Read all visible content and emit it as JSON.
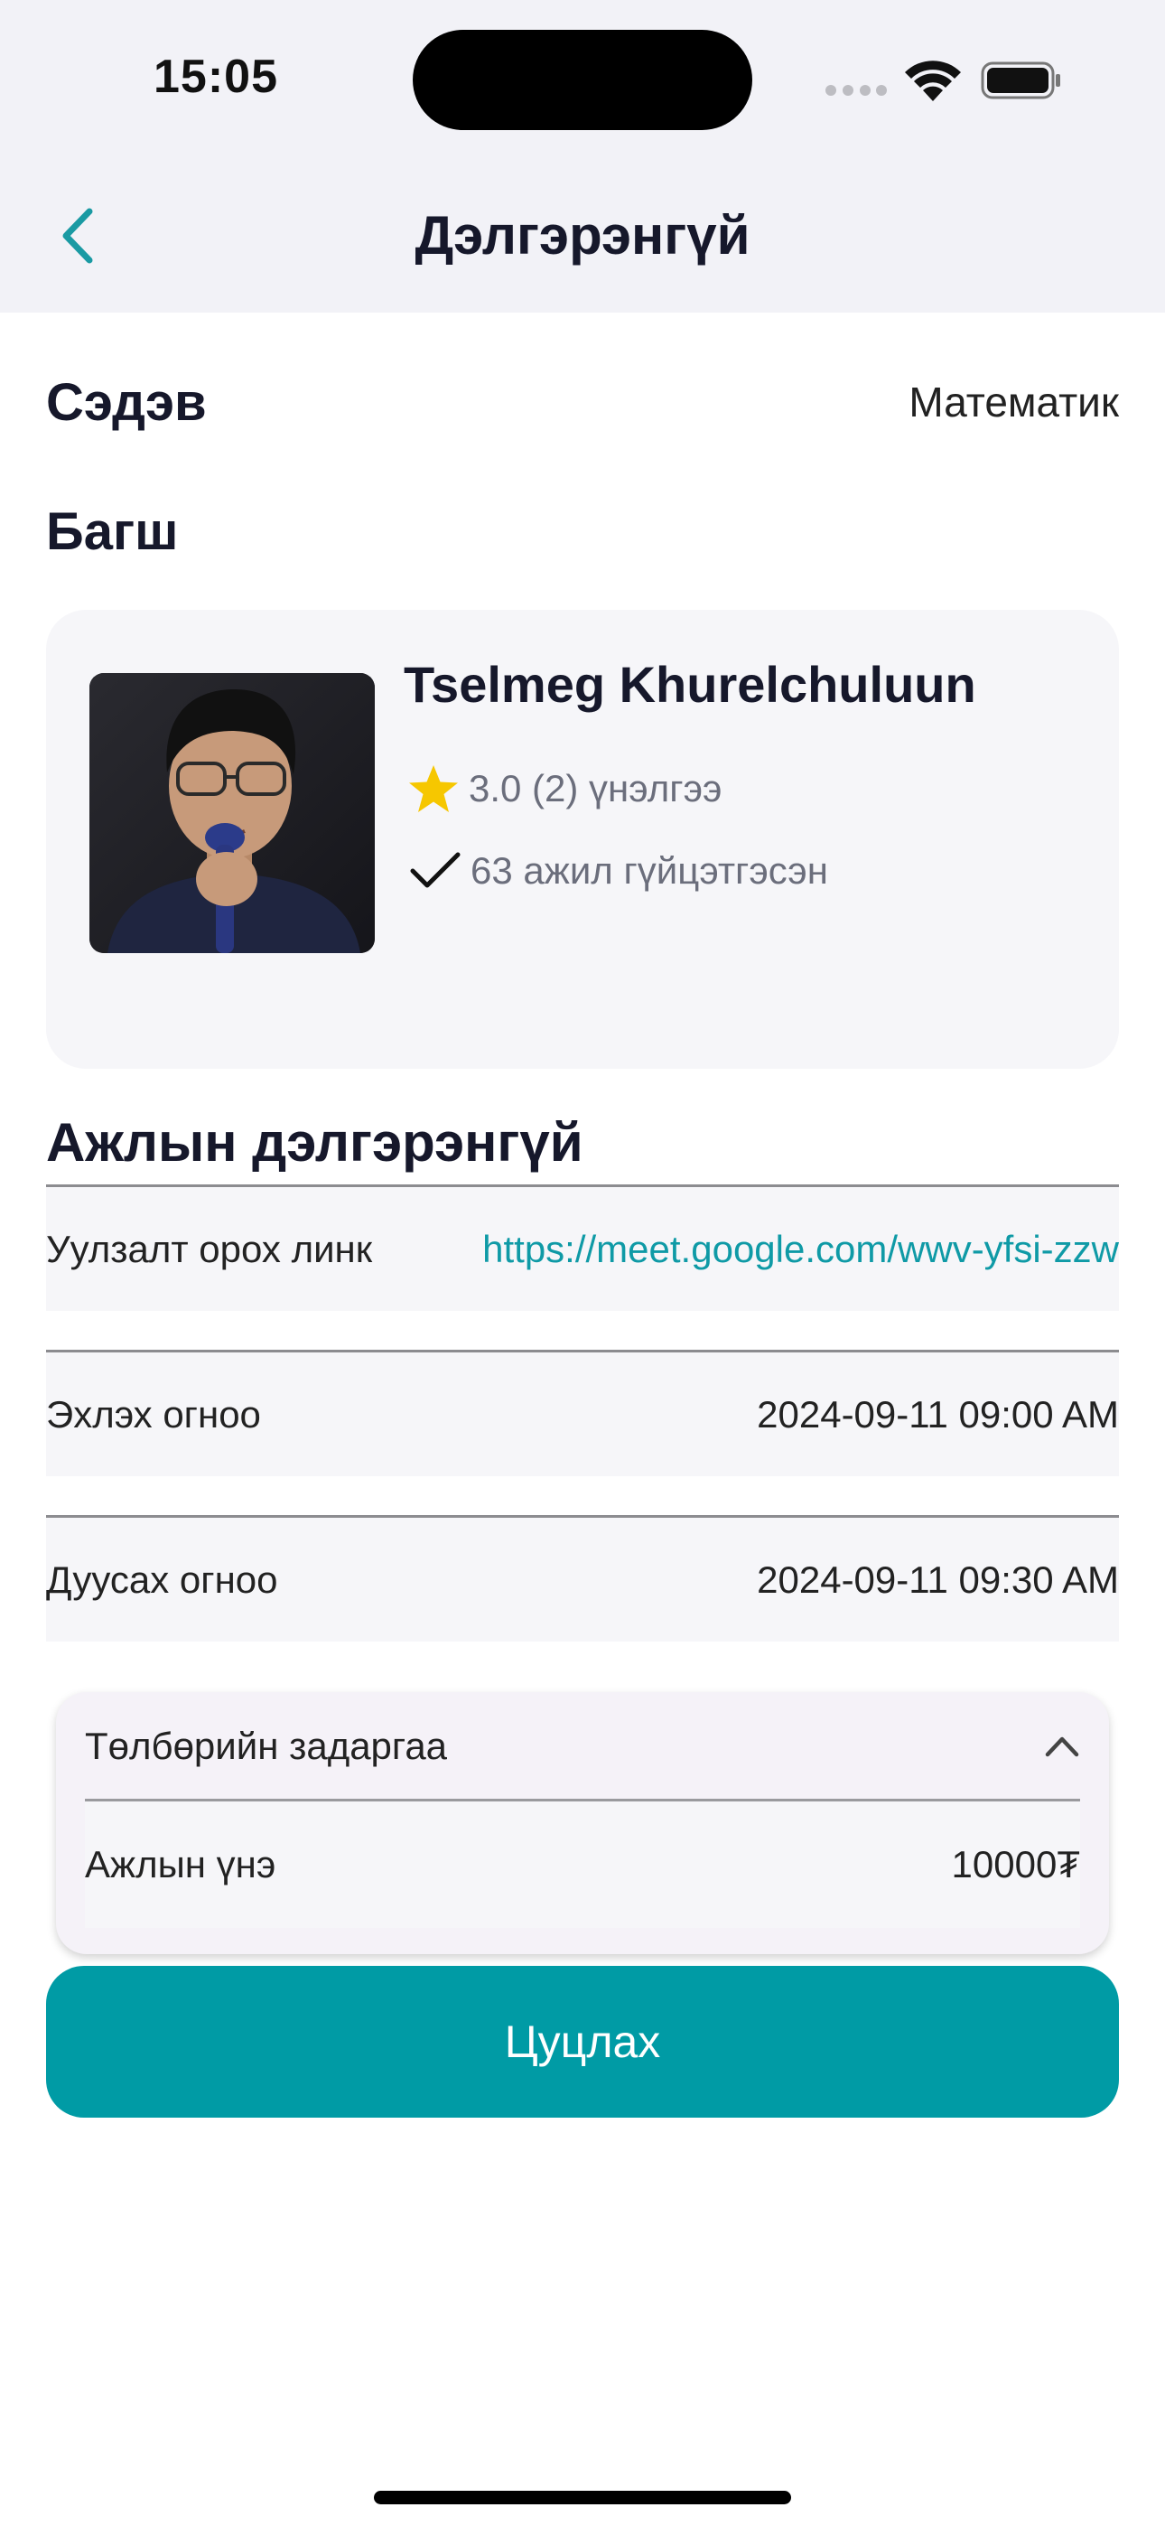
{
  "status_bar": {
    "time": "15:05"
  },
  "nav": {
    "title": "Дэлгэрэнгүй",
    "back_icon": "chevron-left-icon",
    "accent": "#1a9aa3"
  },
  "subject": {
    "label": "Сэдэв",
    "value": "Математик"
  },
  "teacher": {
    "heading": "Багш",
    "name": "Tselmeg Khurelchuluun",
    "rating_text": "3.0 (2) үнэлгээ",
    "jobs_text": "63 ажил гүйцэтгэсэн",
    "star_color": "#f6c700"
  },
  "details": {
    "heading": "Ажлын дэлгэрэнгүй",
    "rows": [
      {
        "label": "Уулзалт орох линк",
        "value": "https://meet.google.com/wwv-yfsi-zzw"
      },
      {
        "label": "Эхлэх огноо",
        "value": "2024-09-11 09:00 AM"
      },
      {
        "label": "Дуусах огноо",
        "value": "2024-09-11 09:30 AM"
      }
    ]
  },
  "payment": {
    "title": "Төлбөрийн задаргаа",
    "row_label": "Ажлын үнэ",
    "row_value": "10000₮"
  },
  "cancel_button": {
    "label": "Цуцлах",
    "color": "#009ba5"
  }
}
